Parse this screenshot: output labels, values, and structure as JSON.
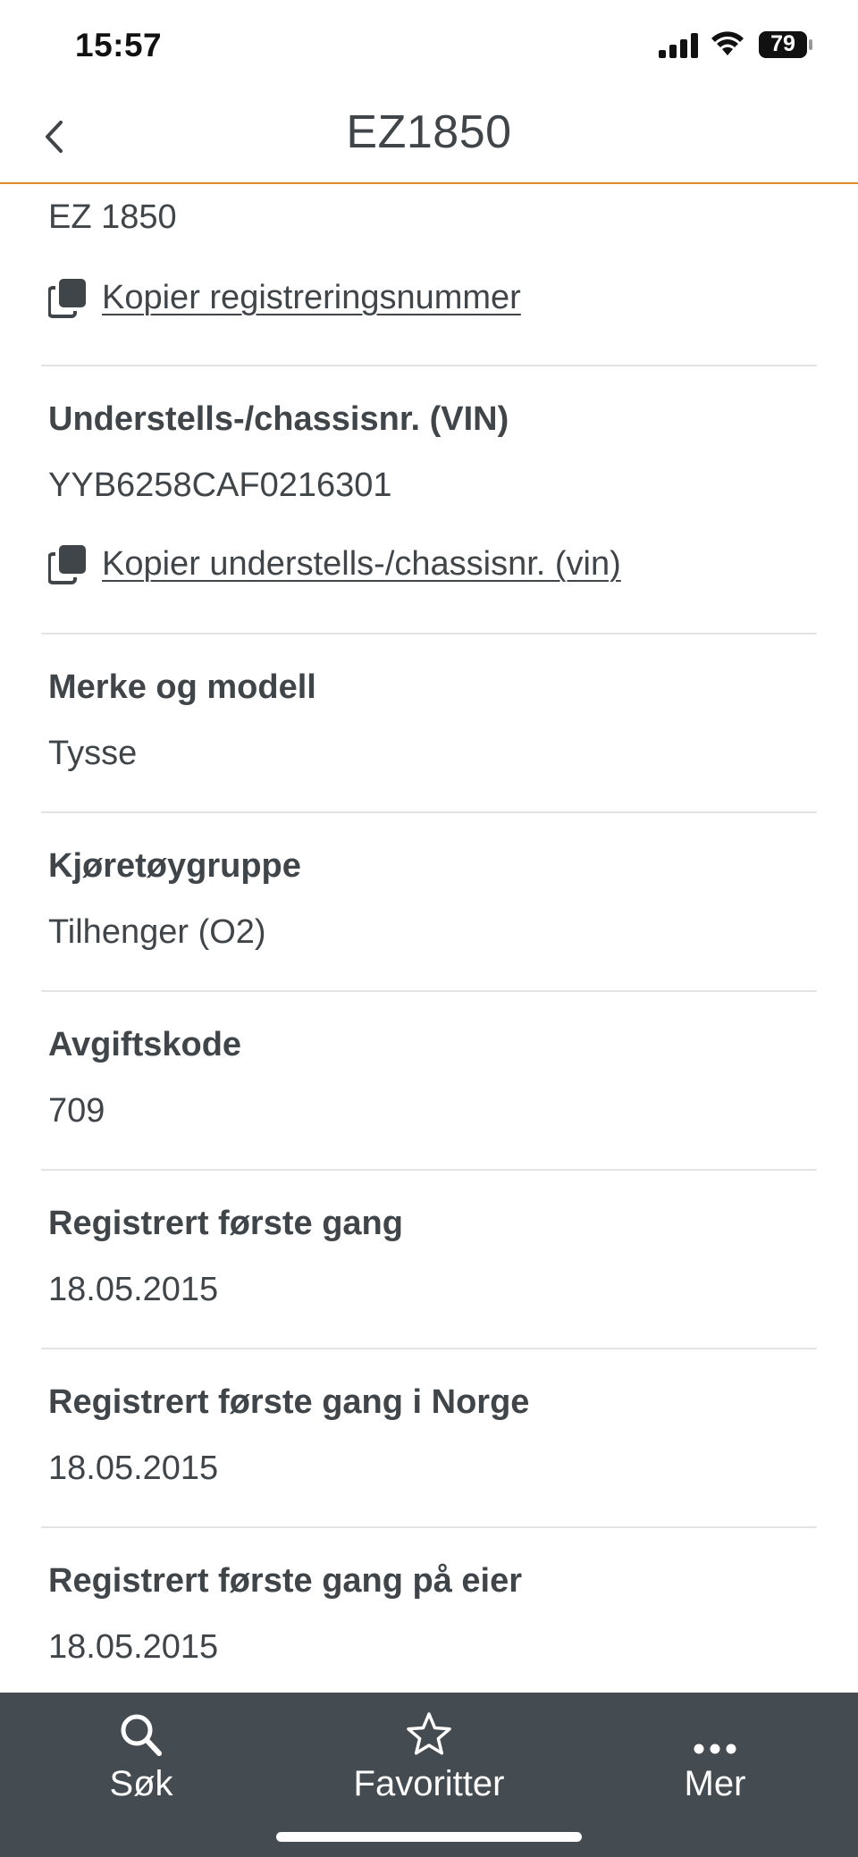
{
  "status_bar": {
    "time": "15:57",
    "battery": "79"
  },
  "header": {
    "title": "EZ1850",
    "back_icon": "chevron-left-icon"
  },
  "registration": {
    "value": "EZ 1850",
    "copy_label": "Kopier registreringsnummer"
  },
  "vin": {
    "label": "Understells-/chassisnr. (VIN)",
    "value": "YYB6258CAF0216301",
    "copy_label": "Kopier understells-/chassisnr. (vin)"
  },
  "details": [
    {
      "label": "Merke og modell",
      "value": "Tysse"
    },
    {
      "label": "Kjøretøygruppe",
      "value": "Tilhenger (O2)"
    },
    {
      "label": "Avgiftskode",
      "value": "709"
    },
    {
      "label": "Registrert første gang",
      "value": "18.05.2015"
    },
    {
      "label": "Registrert første gang i Norge",
      "value": "18.05.2015"
    },
    {
      "label": "Registrert første gang på eier",
      "value": "18.05.2015"
    }
  ],
  "tabs": [
    {
      "label": "Søk",
      "icon": "search-icon"
    },
    {
      "label": "Favoritter",
      "icon": "star-icon"
    },
    {
      "label": "Mer",
      "icon": "more-dots-icon"
    }
  ],
  "colors": {
    "accent": "#e08a2c",
    "text": "#3f4549",
    "tabbar_bg": "#454c51",
    "divider": "#e1e3e5"
  }
}
